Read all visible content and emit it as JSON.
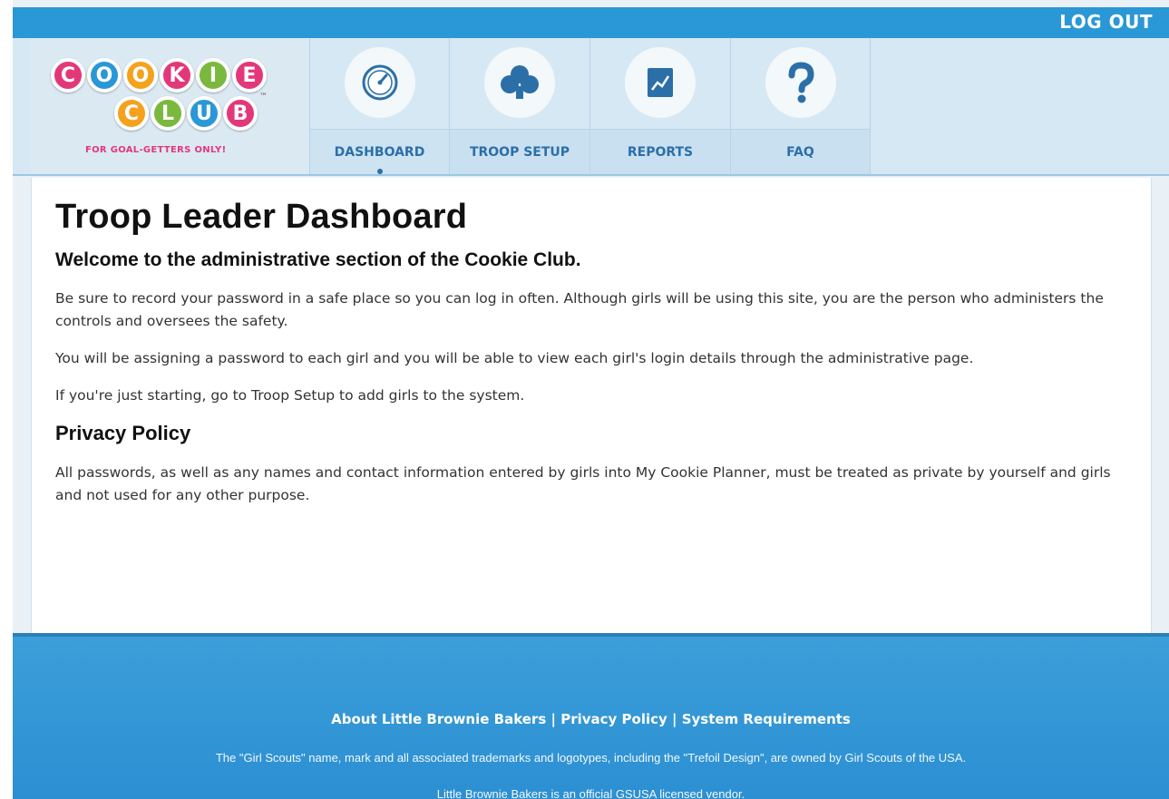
{
  "header": {
    "logout_label": "LOG OUT"
  },
  "logo": {
    "row1": [
      "C",
      "O",
      "O",
      "K",
      "I",
      "E"
    ],
    "row2": [
      "C",
      "L",
      "U",
      "B"
    ],
    "tm": "™",
    "tagline": "FOR GOAL-GETTERS ONLY!",
    "colors_row1": [
      "#e2387a",
      "#2a97d6",
      "#f4a21c",
      "#e2387a",
      "#7ab83e",
      "#e2387a"
    ],
    "colors_row2": [
      "#f4a21c",
      "#7ab83e",
      "#2a97d6",
      "#e2387a"
    ]
  },
  "nav": {
    "tabs": [
      {
        "label": "DASHBOARD",
        "icon": "dashboard-gauge-icon",
        "active": true
      },
      {
        "label": "TROOP SETUP",
        "icon": "trefoil-icon",
        "active": false
      },
      {
        "label": "REPORTS",
        "icon": "report-chart-icon",
        "active": false
      },
      {
        "label": "FAQ",
        "icon": "question-mark-icon",
        "active": false
      }
    ]
  },
  "main": {
    "title": "Troop Leader Dashboard",
    "welcome": "Welcome to the administrative section of the Cookie Club.",
    "paragraphs": [
      "Be sure to record your password in a safe place so you can log in often. Although girls will be using this site, you are the person who administers the controls and oversees the safety.",
      "You will be assigning a password to each girl and you will be able to view each girl's login details through the administrative page.",
      "If you're just starting, go to Troop Setup to add girls to the system."
    ],
    "privacy_heading": "Privacy Policy",
    "privacy_text": "All passwords, as well as any names and contact information entered by girls into My Cookie Planner, must be treated as private by yourself and girls and not used for any other purpose."
  },
  "footer": {
    "links": [
      "About Little Brownie Bakers",
      "Privacy Policy",
      "System Requirements"
    ],
    "separator": " | ",
    "notice": "The \"Girl Scouts\" name, mark and all associated trademarks and logotypes, including the \"Trefoil Design\", are owned by Girl Scouts of the USA.",
    "vendor": "Little Brownie Bakers is an official GSUSA licensed vendor."
  },
  "colors": {
    "brand_blue": "#2a97d6",
    "nav_label": "#2c6fa8"
  }
}
